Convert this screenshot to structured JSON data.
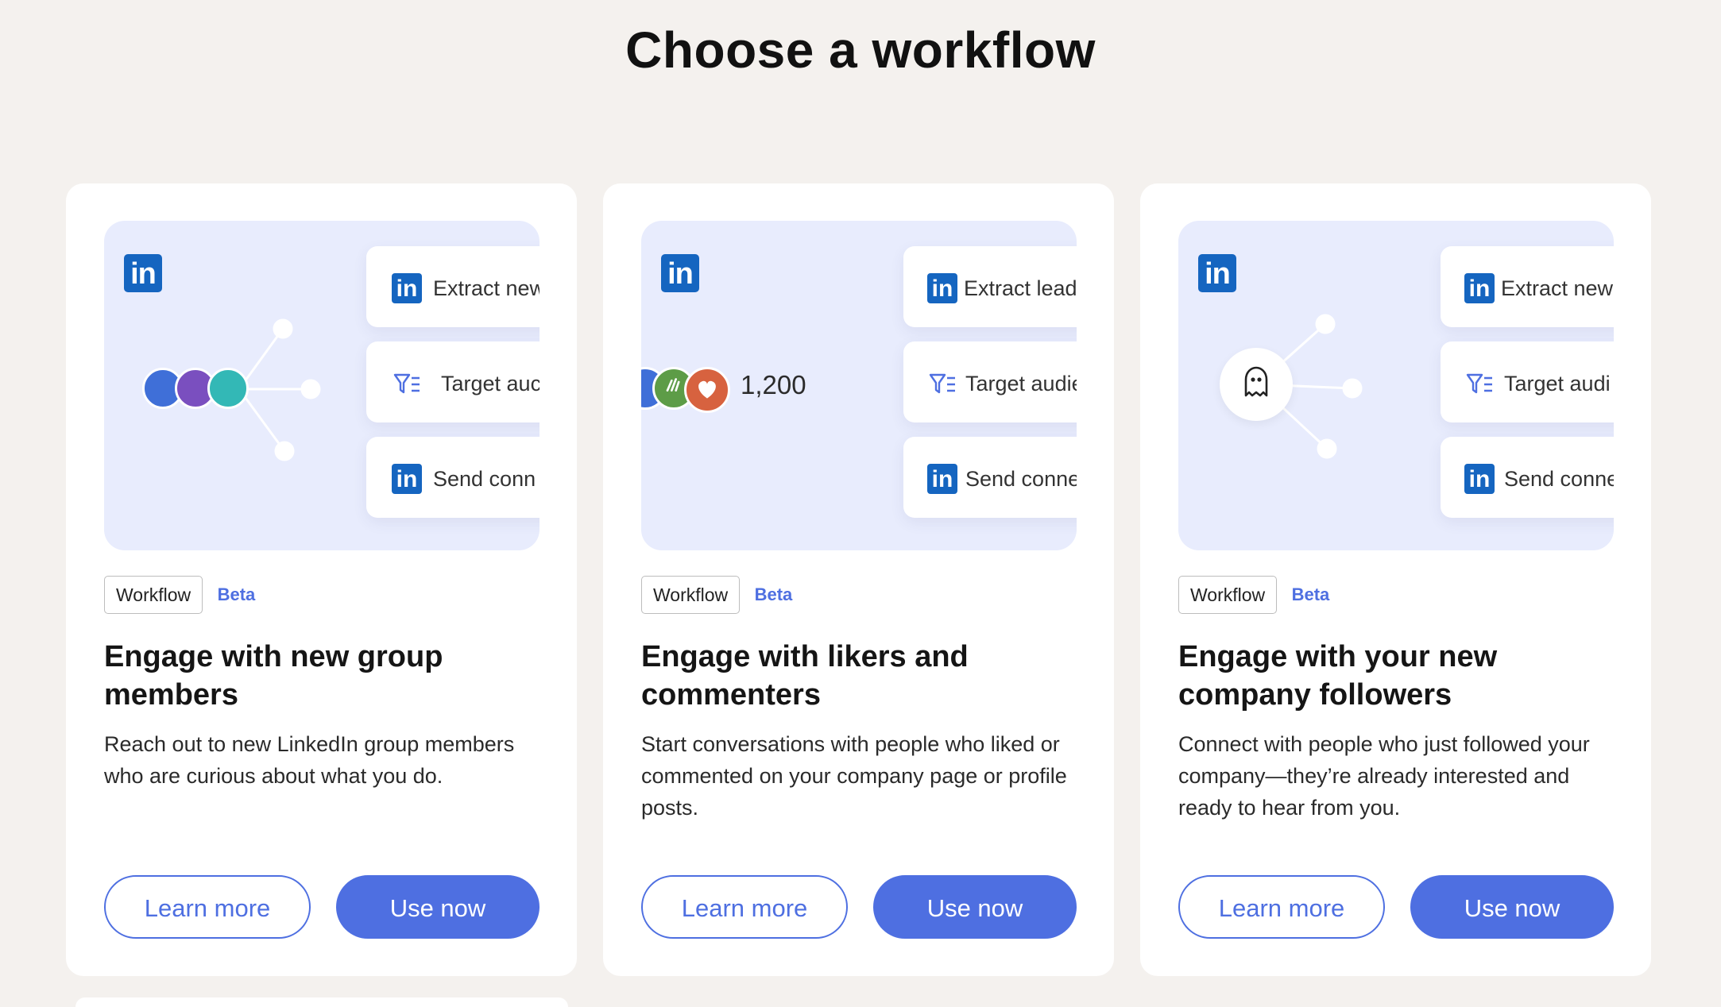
{
  "page": {
    "title": "Choose a workflow"
  },
  "colors": {
    "accent": "#4e6fe1",
    "linkedin": "#1565c0",
    "preview_bg": "#e8ecfd",
    "page_bg": "#f4f1ee"
  },
  "cards": [
    {
      "tag": "Workflow",
      "badge": "Beta",
      "title": "Engage with new group members",
      "description": "Reach out to new LinkedIn group members who are curious about what you do.",
      "steps": [
        "Extract new",
        "Target auc",
        "Send conn"
      ],
      "hub_icon": "group-avatars",
      "learn_label": "Learn more",
      "use_label": "Use now"
    },
    {
      "tag": "Workflow",
      "badge": "Beta",
      "title": "Engage with likers and commenters",
      "description": "Start conversations with people who liked or commented on your company page or profile posts.",
      "steps": [
        "Extract leads from",
        "Target audience f",
        "Send connection"
      ],
      "hub_icon": "reaction-avatars",
      "count": "1,200",
      "learn_label": "Learn more",
      "use_label": "Use now"
    },
    {
      "tag": "Workflow",
      "badge": "Beta",
      "title": "Engage with your new company followers",
      "description": "Connect with people who just followed your company—they’re already interested and ready to hear from you.",
      "steps": [
        "Extract new",
        "Target audi",
        "Send conne"
      ],
      "hub_icon": "ghost-icon",
      "learn_label": "Learn more",
      "use_label": "Use now"
    }
  ],
  "linkedin_glyph": "in"
}
